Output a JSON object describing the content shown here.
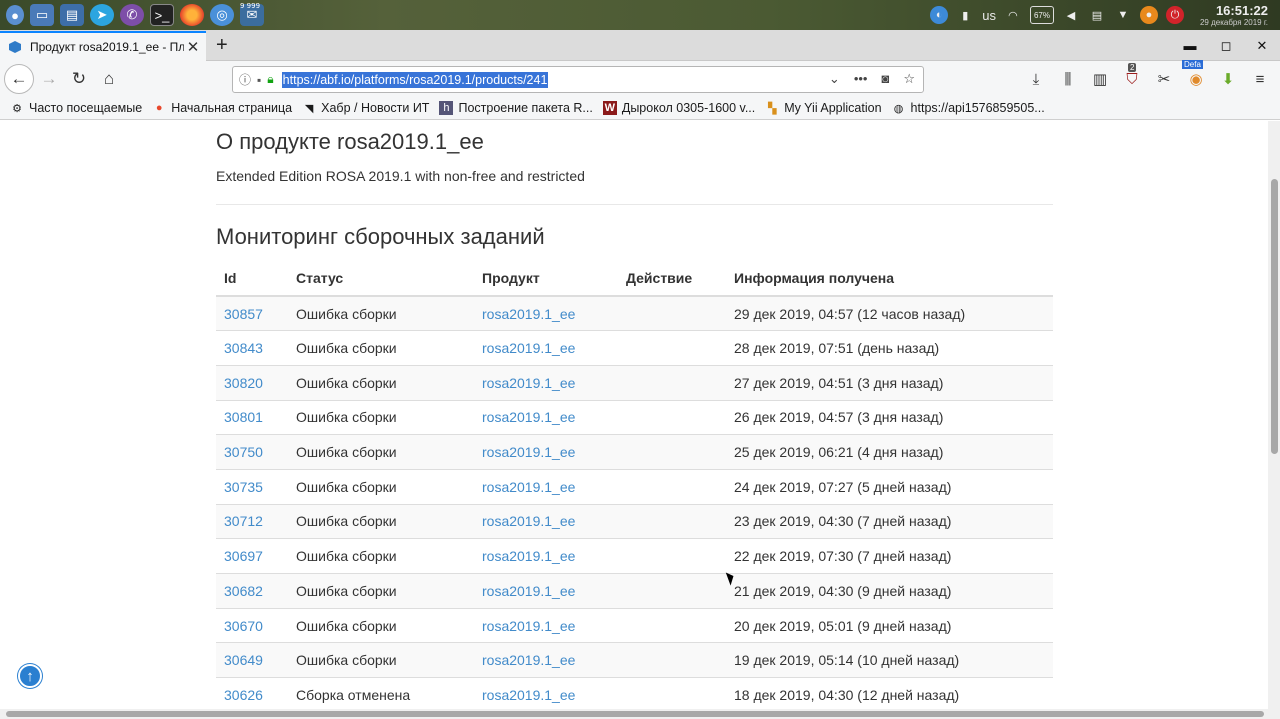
{
  "taskbar": {
    "apps": [
      "app-launcher",
      "desktop",
      "file-manager",
      "telegram",
      "viber",
      "terminal",
      "firefox",
      "chromium",
      "mail"
    ],
    "mail_badge": "9 999",
    "keyboard_layout": "us",
    "battery": "67%",
    "time": "16:51:22",
    "date": "29 декабря 2019 г."
  },
  "tab": {
    "title": "Продукт rosa2019.1_ee - Пл"
  },
  "url": "https://abf.io/platforms/rosa2019.1/products/241",
  "toolbar": {
    "ublock_badge": "2",
    "defa_badge": "Defa"
  },
  "bookmarks": [
    {
      "label": "Часто посещаемые",
      "icon": "gear-icon"
    },
    {
      "label": "Начальная страница",
      "icon": "firefox-icon"
    },
    {
      "label": "Хабр / Новости ИТ",
      "icon": "rss-icon"
    },
    {
      "label": "Построение пакета R...",
      "icon": "h-icon"
    },
    {
      "label": "Дырокол 0305-1600 v...",
      "icon": "w-icon"
    },
    {
      "label": "My Yii Application",
      "icon": "yii-icon"
    },
    {
      "label": "https://api1576859505...",
      "icon": "globe-icon"
    }
  ],
  "page": {
    "title": "О продукте rosa2019.1_ee",
    "description": "Extended Edition ROSA 2019.1 with non-free and restricted",
    "monitoring_title": "Мониторинг сборочных заданий",
    "columns": [
      "Id",
      "Статус",
      "Продукт",
      "Действие",
      "Информация получена"
    ],
    "rows": [
      {
        "id": "30857",
        "status": "Ошибка сборки",
        "product": "rosa2019.1_ee",
        "action": "",
        "info": "29 дек 2019, 04:57 (12 часов назад)"
      },
      {
        "id": "30843",
        "status": "Ошибка сборки",
        "product": "rosa2019.1_ee",
        "action": "",
        "info": "28 дек 2019, 07:51 (день назад)"
      },
      {
        "id": "30820",
        "status": "Ошибка сборки",
        "product": "rosa2019.1_ee",
        "action": "",
        "info": "27 дек 2019, 04:51 (3 дня назад)"
      },
      {
        "id": "30801",
        "status": "Ошибка сборки",
        "product": "rosa2019.1_ee",
        "action": "",
        "info": "26 дек 2019, 04:57 (3 дня назад)"
      },
      {
        "id": "30750",
        "status": "Ошибка сборки",
        "product": "rosa2019.1_ee",
        "action": "",
        "info": "25 дек 2019, 06:21 (4 дня назад)"
      },
      {
        "id": "30735",
        "status": "Ошибка сборки",
        "product": "rosa2019.1_ee",
        "action": "",
        "info": "24 дек 2019, 07:27 (5 дней назад)"
      },
      {
        "id": "30712",
        "status": "Ошибка сборки",
        "product": "rosa2019.1_ee",
        "action": "",
        "info": "23 дек 2019, 04:30 (7 дней назад)"
      },
      {
        "id": "30697",
        "status": "Ошибка сборки",
        "product": "rosa2019.1_ee",
        "action": "",
        "info": "22 дек 2019, 07:30 (7 дней назад)"
      },
      {
        "id": "30682",
        "status": "Ошибка сборки",
        "product": "rosa2019.1_ee",
        "action": "",
        "info": "21 дек 2019, 04:30 (9 дней назад)"
      },
      {
        "id": "30670",
        "status": "Ошибка сборки",
        "product": "rosa2019.1_ee",
        "action": "",
        "info": "20 дек 2019, 05:01 (9 дней назад)"
      },
      {
        "id": "30649",
        "status": "Ошибка сборки",
        "product": "rosa2019.1_ee",
        "action": "",
        "info": "19 дек 2019, 05:14 (10 дней назад)"
      },
      {
        "id": "30626",
        "status": "Сборка отменена",
        "product": "rosa2019.1_ee",
        "action": "",
        "info": "18 дек 2019, 04:30 (12 дней назад)"
      }
    ]
  },
  "colors": {
    "link": "#428bca",
    "accent": "#0a84ff",
    "url_highlight": "#3874d8"
  }
}
